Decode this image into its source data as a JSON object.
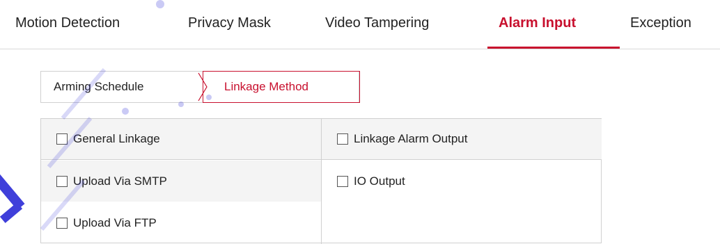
{
  "top_tabs": [
    {
      "label": "Motion Detection"
    },
    {
      "label": "Privacy Mask"
    },
    {
      "label": "Video Tampering"
    },
    {
      "label": "Alarm Input",
      "active": true
    },
    {
      "label": "Exception"
    }
  ],
  "sub_tabs": [
    {
      "label": "Arming Schedule"
    },
    {
      "label": "Linkage Method",
      "active": true
    }
  ],
  "linkage": {
    "left": [
      {
        "label": "General Linkage",
        "checked": false
      },
      {
        "label": "Upload Via SMTP",
        "checked": false
      },
      {
        "label": "Upload Via FTP",
        "checked": false
      }
    ],
    "right": [
      {
        "label": "Linkage Alarm Output",
        "checked": false
      },
      {
        "label": "IO Output",
        "checked": false
      }
    ]
  },
  "colors": {
    "accent": "#c8102e",
    "watermark": "#2b2bd6"
  }
}
